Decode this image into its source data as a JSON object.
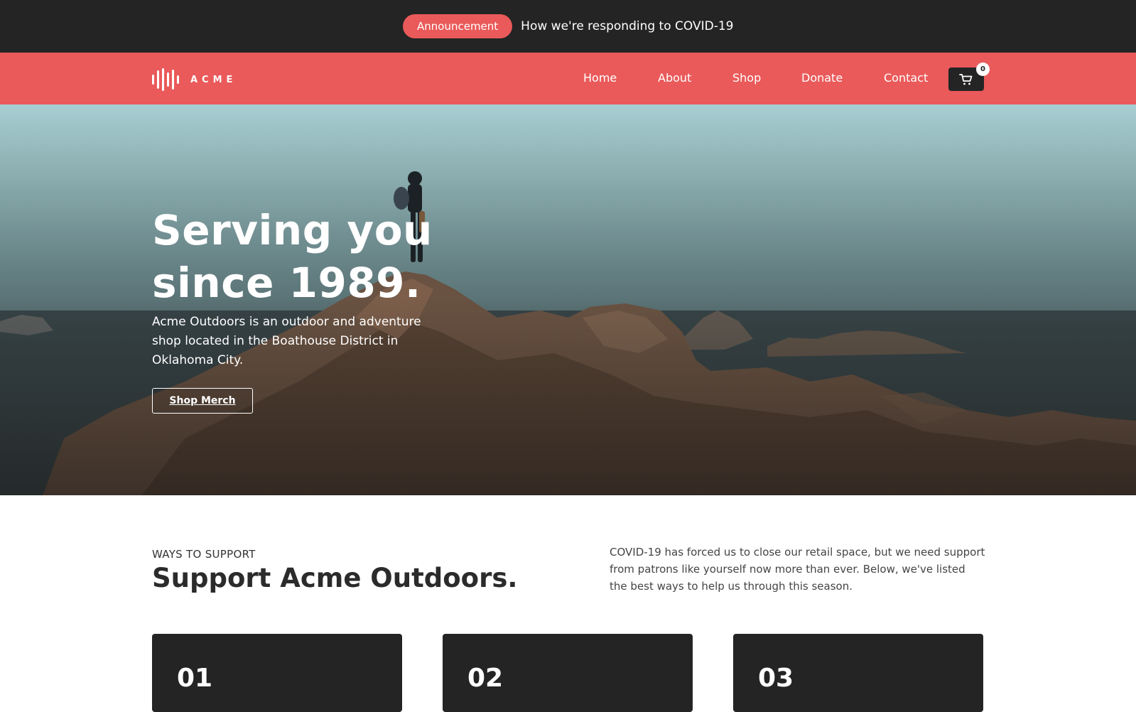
{
  "announcement": {
    "badge": "Announcement",
    "text": "How we're responding to COVID-19"
  },
  "nav": {
    "brand": "ACME",
    "items": [
      {
        "label": "Home"
      },
      {
        "label": "About"
      },
      {
        "label": "Shop"
      },
      {
        "label": "Donate"
      },
      {
        "label": "Contact"
      }
    ],
    "cart_count": "0"
  },
  "hero": {
    "title_line1": "Serving you",
    "title_line2": "since 1989.",
    "description": "Acme Outdoors is an outdoor and adventure shop located in the Boathouse District in Oklahoma City.",
    "cta": "Shop Merch"
  },
  "support": {
    "eyebrow": "WAYS TO SUPPORT",
    "title": "Support Acme Outdoors.",
    "description": "COVID-19 has forced us to close our retail space, but we need support from patrons like yourself now more than ever. Below, we've listed the best ways to help us through this season.",
    "cards": [
      {
        "number": "01"
      },
      {
        "number": "02"
      },
      {
        "number": "03"
      }
    ]
  },
  "colors": {
    "accent": "#ea5a5a",
    "dark": "#242424"
  }
}
